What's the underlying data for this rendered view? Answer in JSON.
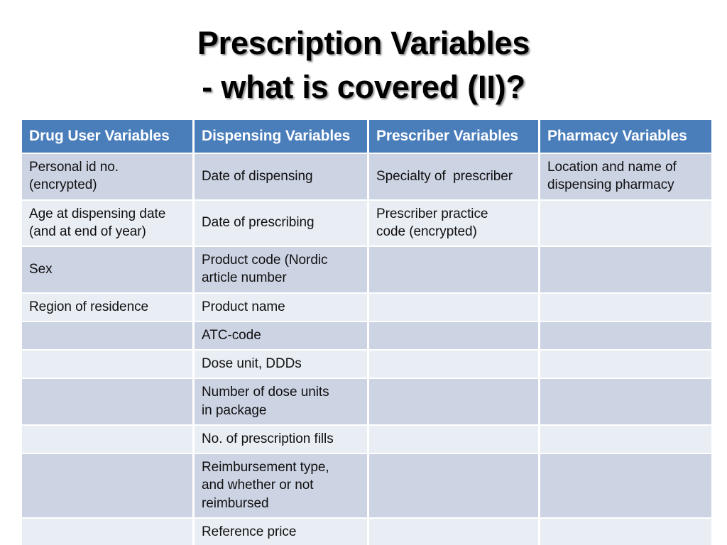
{
  "title": {
    "line1": "Prescription Variables",
    "line2": "- what is covered (II)?"
  },
  "colors": {
    "header_bg": "#4a7ebb",
    "header_text": "#ffffff",
    "row_dark": "#ccd3e3",
    "row_light": "#e9edf4",
    "page_bg": "#ffffff",
    "body_text": "#101010"
  },
  "table": {
    "headers": [
      "Drug User Variables",
      "Dispensing Variables",
      "Prescriber Variables",
      "Pharmacy Variables"
    ],
    "rows": [
      [
        "Personal id no.\n(encrypted)",
        "Date of dispensing",
        "Specialty of  prescriber",
        "Location and name of\ndispensing pharmacy"
      ],
      [
        "Age at dispensing date\n(and at end of year)",
        "Date of prescribing",
        "Prescriber practice\ncode (encrypted)",
        ""
      ],
      [
        "Sex",
        "Product code (Nordic\narticle number",
        "",
        ""
      ],
      [
        "Region of residence",
        "Product name",
        "",
        ""
      ],
      [
        "",
        "ATC-code",
        "",
        ""
      ],
      [
        "",
        "Dose unit, DDDs",
        "",
        ""
      ],
      [
        "",
        "Number of dose units\nin package",
        "",
        ""
      ],
      [
        "",
        "No. of prescription fills",
        "",
        ""
      ],
      [
        "",
        "Reimbursement type,\nand whether or not\nreimbursed",
        "",
        ""
      ],
      [
        "",
        "Reference price",
        "",
        ""
      ]
    ]
  }
}
